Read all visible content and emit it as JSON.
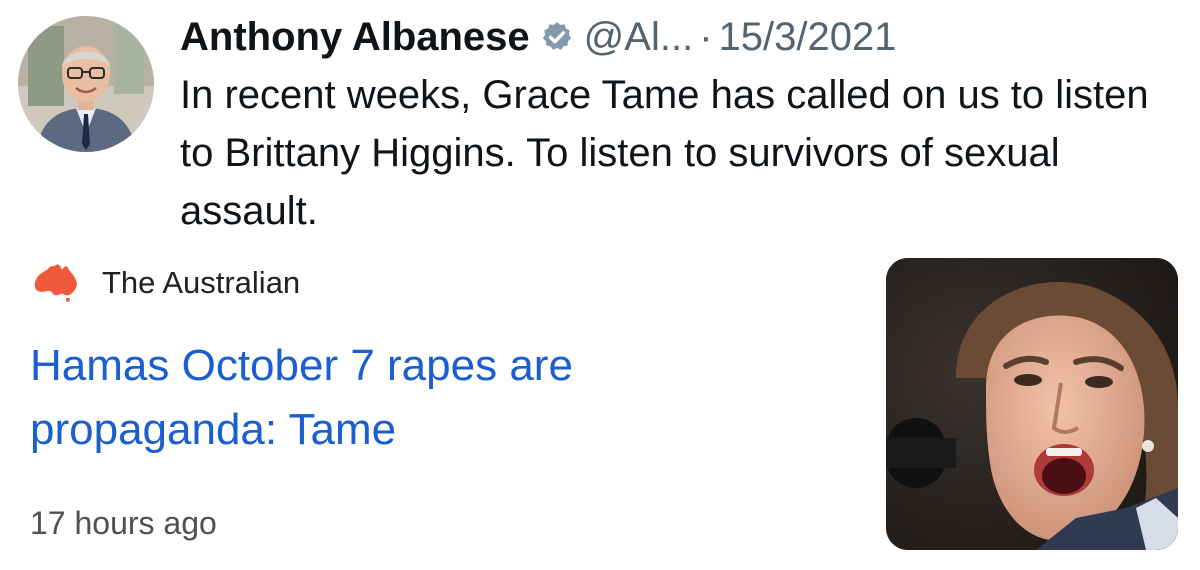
{
  "tweet": {
    "author_name": "Anthony Albanese",
    "handle": "@Al...",
    "separator": "·",
    "date": "15/3/2021",
    "text": "In recent weeks, Grace Tame has called on us to listen to Brittany Higgins. To listen to survivors of sexual assault.",
    "avatar_icon": "profile-photo",
    "verified_icon": "verified-badge-icon"
  },
  "news_card": {
    "source_name": "The Australian",
    "source_logo_icon": "australia-map-icon",
    "headline": "Hamas October 7 rapes are propaganda: Tame",
    "time_ago": "17 hours ago",
    "thumbnail_icon": "article-photo"
  },
  "colors": {
    "headline_link": "#1a5fd1",
    "secondary_text": "#536471",
    "australia_logo": "#ef5a3c",
    "verified_badge": "#829aab"
  }
}
